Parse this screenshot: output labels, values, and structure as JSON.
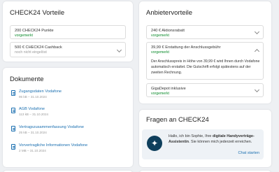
{
  "vorteile": {
    "title": "CHECK24 Vorteile",
    "items": [
      {
        "label": "200 CHECK24 Punkte",
        "status": "vorgemerkt"
      },
      {
        "label": "500 € CHECK24 Cashback",
        "status": "noch nicht eingelöst"
      }
    ]
  },
  "anbieter": {
    "title": "Anbietervorteile",
    "items": [
      {
        "label": "240 € Aktionsrabatt",
        "status": "vorgemerkt"
      },
      {
        "label": "39,99 € Erstattung der Anschlussgebühr",
        "status": "vorgemerkt",
        "description": "Der Anschlusspreis in Höhe von 39,99 € wird Ihnen durch Vodafone automatisch erstattet. Die Gutschrift erfolgt spätestens auf der zweiten Rechnung."
      },
      {
        "label": "GigaDepot inklusive",
        "status": "vorgemerkt"
      }
    ]
  },
  "dokumente": {
    "title": "Dokumente",
    "items": [
      {
        "name": "Zugangsdaten Vodafone",
        "meta": "95 kB – 31.10.2024"
      },
      {
        "name": "AGB Vodafone",
        "meta": "113 kB – 31.10.2024"
      },
      {
        "name": "Vertragszusammenfassung Vodafone",
        "meta": "25 kB – 31.10.2024"
      },
      {
        "name": "Vorvertragliche Informationen Vodafone",
        "meta": "2 MB – 31.10.2024"
      }
    ]
  },
  "fragen": {
    "title": "Fragen an CHECK24",
    "text_pre": "Hallo, ich bin Sophie, Ihre ",
    "text_bold": "digitale Handyverträge-Assistentin",
    "text_post": ". Sie können mich jederzeit erreichen.",
    "link": "Chat starten"
  },
  "colors": {
    "green": "#0a8a2a",
    "link": "#1a6fb0",
    "avatar": "#0e3f5c"
  }
}
